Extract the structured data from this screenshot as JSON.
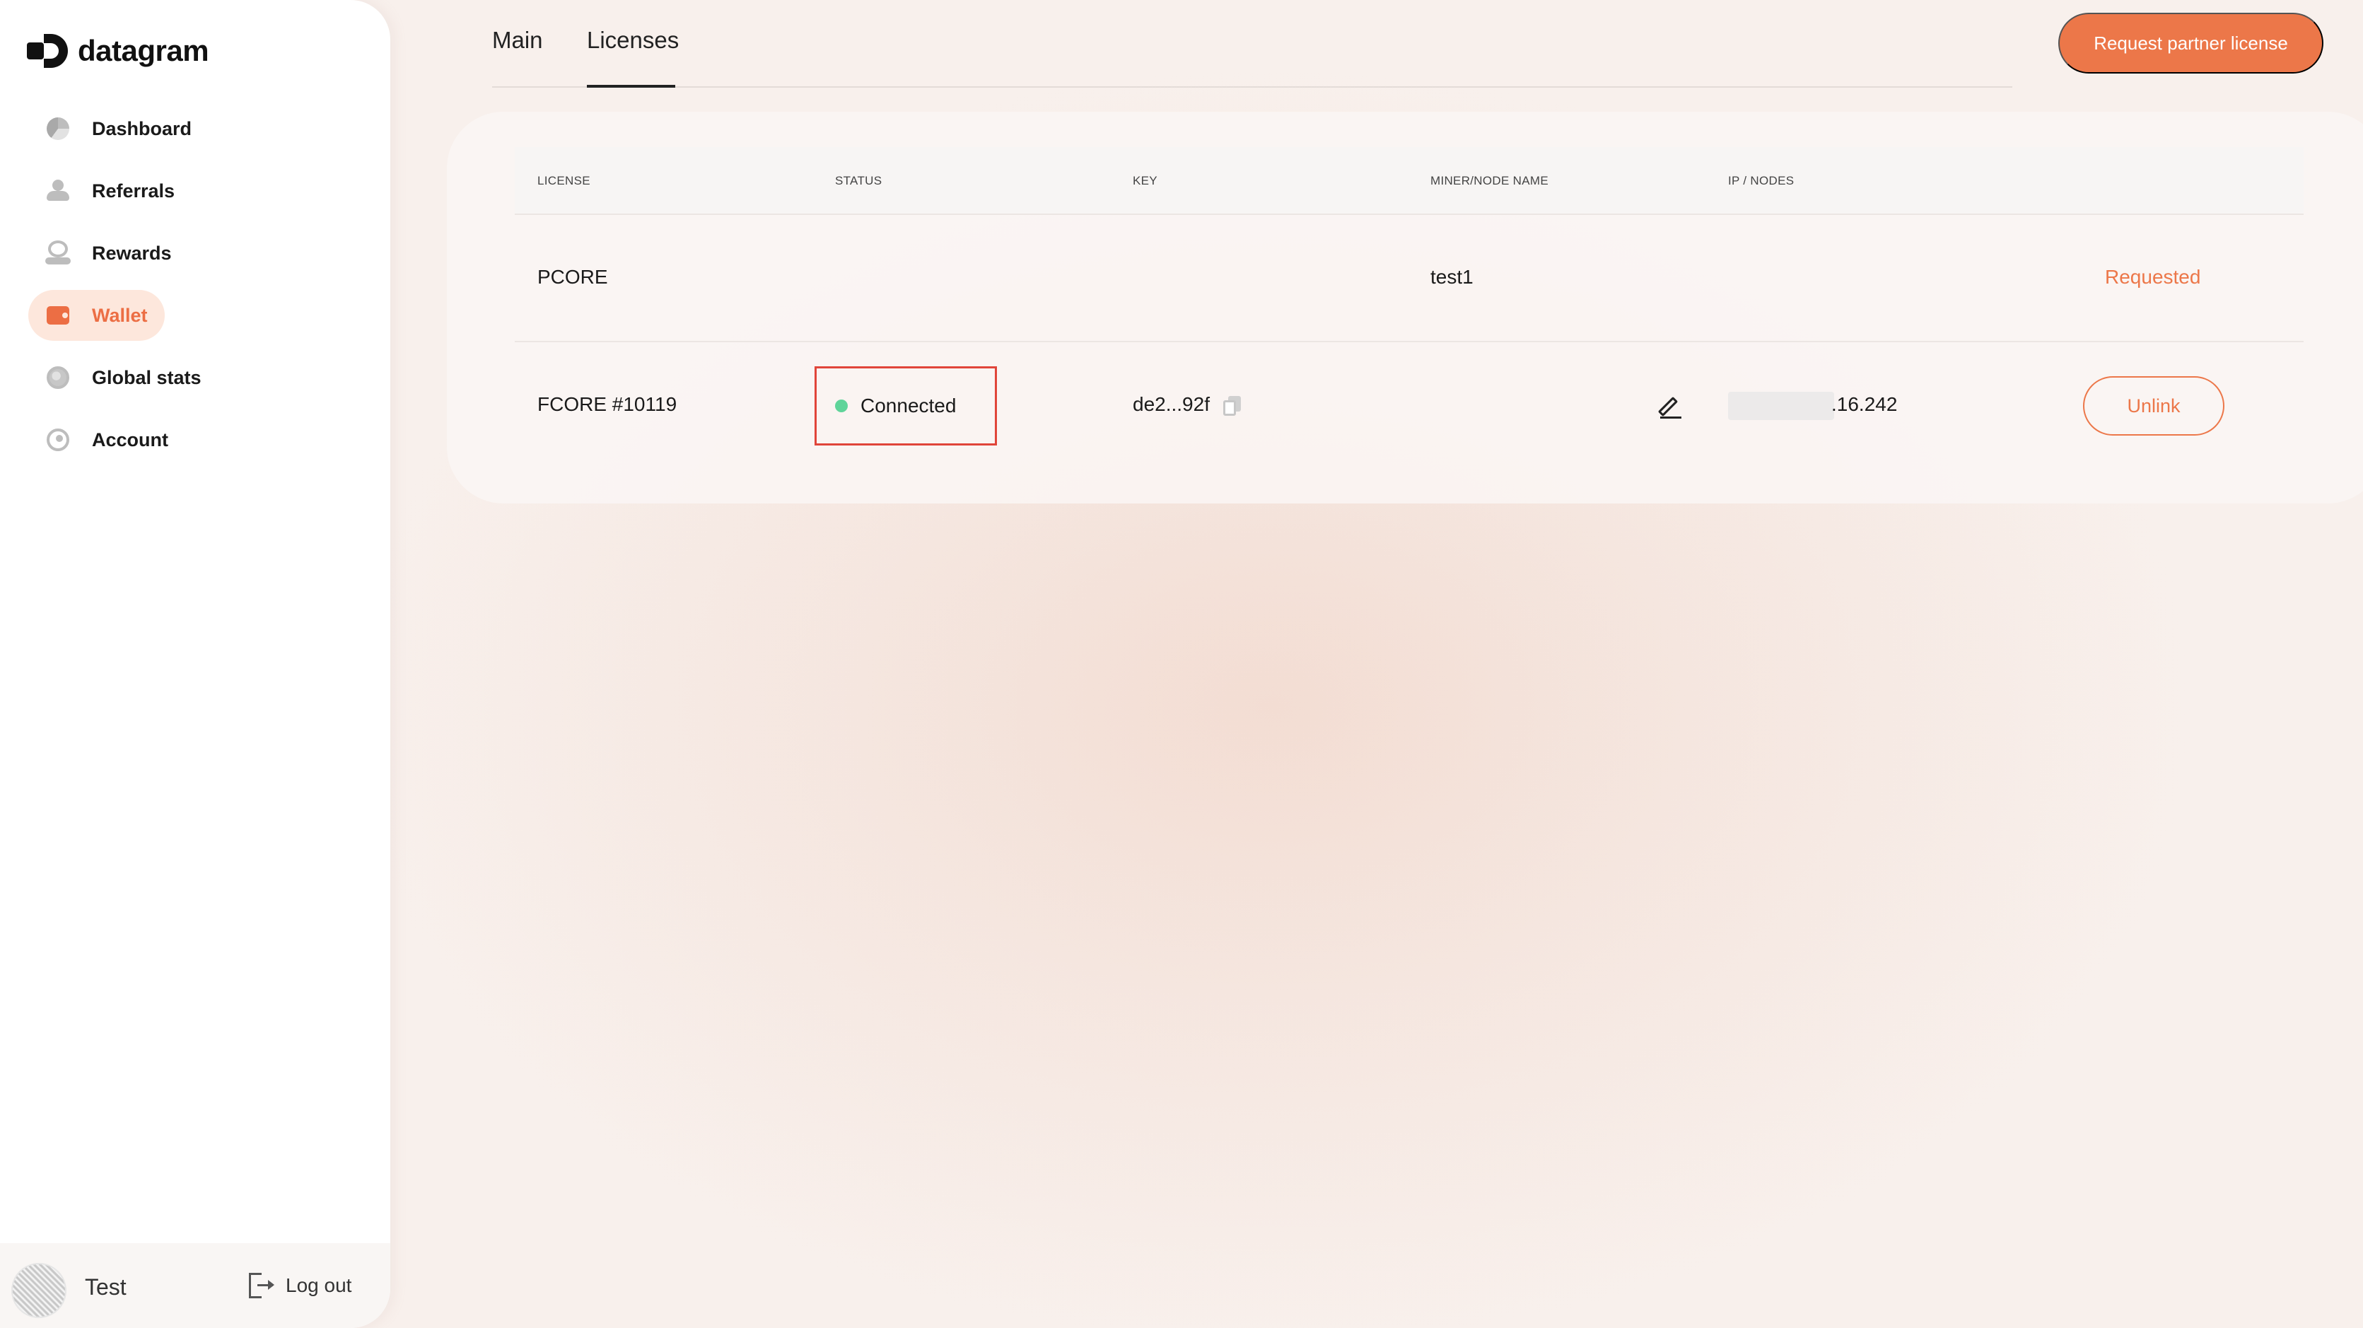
{
  "app": {
    "brand": "datagram"
  },
  "sidebar": {
    "items": [
      {
        "label": "Dashboard",
        "icon": "dashboard-icon"
      },
      {
        "label": "Referrals",
        "icon": "referrals-icon"
      },
      {
        "label": "Rewards",
        "icon": "rewards-icon"
      },
      {
        "label": "Wallet",
        "icon": "wallet-icon",
        "active": true
      },
      {
        "label": "Global stats",
        "icon": "globe-icon"
      },
      {
        "label": "Account",
        "icon": "account-icon"
      }
    ],
    "footer": {
      "user_name": "Test",
      "logout_label": "Log out"
    }
  },
  "tabs": [
    {
      "label": "Main"
    },
    {
      "label": "Licenses",
      "active": true
    }
  ],
  "header": {
    "request_button": "Request partner license"
  },
  "table": {
    "columns": [
      "LICENSE",
      "STATUS",
      "KEY",
      "MINER/NODE NAME",
      "IP / NODES"
    ],
    "rows": [
      {
        "license": "PCORE",
        "status": "",
        "key": "",
        "name": "test1",
        "ip": "",
        "action": "Requested"
      },
      {
        "license": "FCORE #10119",
        "status": "Connected",
        "key": "de2...92f",
        "name": "",
        "ip": ".16.242",
        "action": "Unlink"
      }
    ]
  },
  "colors": {
    "accent": "#ec7749",
    "active_bg": "#fde7dc",
    "status_connected": "#5fd49a",
    "highlight_border": "#e0453a"
  }
}
